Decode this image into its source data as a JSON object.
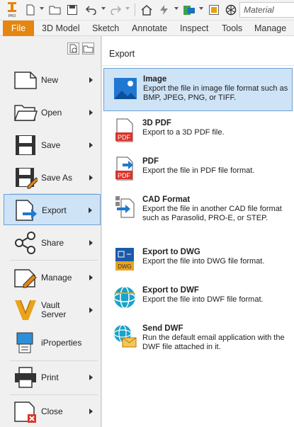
{
  "toolbar": {
    "search_placeholder": "Material",
    "icons": [
      "inventor-pro-logo",
      "new-doc-icon",
      "open-folder-icon",
      "save-icon",
      "undo-icon",
      "redo-icon",
      "home-icon",
      "update-icon",
      "appearance-icon",
      "color-swatch-icon",
      "material-sphere-icon"
    ]
  },
  "ribbon": {
    "file_label": "File",
    "tabs": [
      "3D Model",
      "Sketch",
      "Annotate",
      "Inspect",
      "Tools",
      "Manage"
    ]
  },
  "file_menu": {
    "items": [
      {
        "label": "New",
        "icon": "new-doc-icon"
      },
      {
        "label": "Open",
        "icon": "open-folder-icon"
      },
      {
        "label": "Save",
        "icon": "floppy-disk-icon"
      },
      {
        "label": "Save As",
        "icon": "save-as-icon"
      },
      {
        "label": "Export",
        "icon": "export-icon",
        "selected": true
      },
      {
        "label": "Share",
        "icon": "share-icon"
      },
      {
        "label": "Manage",
        "icon": "manage-icon"
      },
      {
        "label": "Vault\nServer",
        "icon": "vault-icon"
      },
      {
        "label": "iProperties",
        "icon": "iproperties-icon"
      },
      {
        "label": "Print",
        "icon": "printer-icon"
      },
      {
        "label": "Close",
        "icon": "close-doc-icon"
      }
    ]
  },
  "export_panel": {
    "title": "Export",
    "items": [
      {
        "title": "Image",
        "desc": "Export the file in image file format such as BMP, JPEG, PNG, or TIFF.",
        "icon": "image-icon",
        "selected": true
      },
      {
        "title": "3D PDF",
        "desc": "Export to a 3D PDF file.",
        "icon": "pdf-3d-icon",
        "badge": "PDF"
      },
      {
        "title": "PDF",
        "desc": "Export the file in PDF file format.",
        "icon": "pdf-icon",
        "badge": "PDF"
      },
      {
        "title": "CAD Format",
        "desc": "Export the file in another CAD file format such as Parasolid, PRO-E, or STEP.",
        "icon": "cad-format-icon"
      },
      {
        "title": "Export to DWG",
        "desc": "Export the file into DWG file format.",
        "icon": "dwg-icon",
        "badge": "DWG"
      },
      {
        "title": "Export to DWF",
        "desc": "Export the file into DWF file format.",
        "icon": "dwf-globe-icon"
      },
      {
        "title": "Send DWF",
        "desc": "Run the default email application with the DWF file attached in it.",
        "icon": "send-dwf-icon"
      }
    ]
  },
  "colors": {
    "file_tab": "#e4860f",
    "selection_bg": "#cfe3f7",
    "selection_border": "#6aa1d8",
    "pdf_red": "#d9342b",
    "export_blue": "#1f78d1"
  }
}
